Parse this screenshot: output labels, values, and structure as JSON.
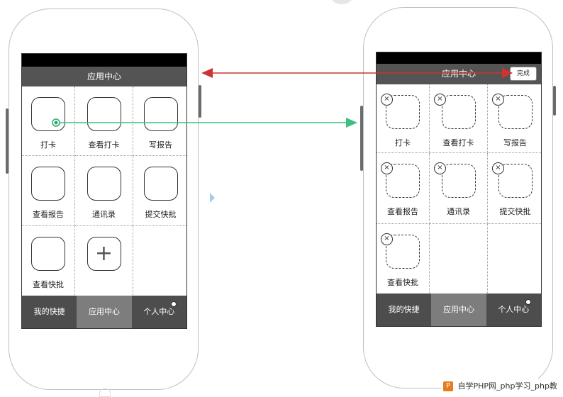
{
  "app": {
    "title": "应用中心"
  },
  "left_phone": {
    "title": "应用中心",
    "apps": [
      {
        "label": "打卡"
      },
      {
        "label": "查看打卡"
      },
      {
        "label": "写报告"
      },
      {
        "label": "查看报告"
      },
      {
        "label": "通讯录"
      },
      {
        "label": "提交快批"
      },
      {
        "label": "查看快批"
      }
    ],
    "add_symbol": "+",
    "tabs": [
      {
        "label": "我的快捷"
      },
      {
        "label": "应用中心"
      },
      {
        "label": "个人中心"
      }
    ]
  },
  "right_phone": {
    "title": "应用中心",
    "done_label": "完成",
    "delete_symbol": "×",
    "apps": [
      {
        "label": "打卡"
      },
      {
        "label": "查看打卡"
      },
      {
        "label": "写报告"
      },
      {
        "label": "查看报告"
      },
      {
        "label": "通讯录"
      },
      {
        "label": "提交快批"
      },
      {
        "label": "查看快批"
      }
    ],
    "tabs": [
      {
        "label": "我的快捷"
      },
      {
        "label": "应用中心"
      },
      {
        "label": "个人中心"
      }
    ]
  },
  "watermark": {
    "logo": "P",
    "text": "自学PHP网_php学习_php教"
  },
  "colors": {
    "red_arrow": "#cc3333",
    "green_arrow": "#3fbf7f",
    "title_bar": "#545454",
    "tab_active": "#7d7d7d",
    "tab_inactive": "#4d4d4d"
  }
}
